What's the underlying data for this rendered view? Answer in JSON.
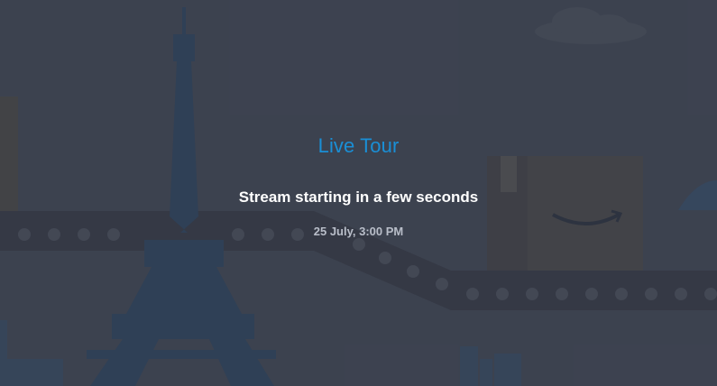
{
  "stream": {
    "title": "Live Tour",
    "status": "Stream starting in a few seconds",
    "datetime": "25 July, 3:00 PM"
  },
  "colors": {
    "background": "#3f4451",
    "title_accent": "#1a8fd6",
    "status_text": "#ffffff",
    "datetime_text": "#b9bec9"
  },
  "illustration": {
    "icons": [
      "eiffel-tower-icon",
      "conveyor-belt-icon",
      "amazon-box-icon",
      "cloud-icon",
      "dome-icon"
    ]
  }
}
